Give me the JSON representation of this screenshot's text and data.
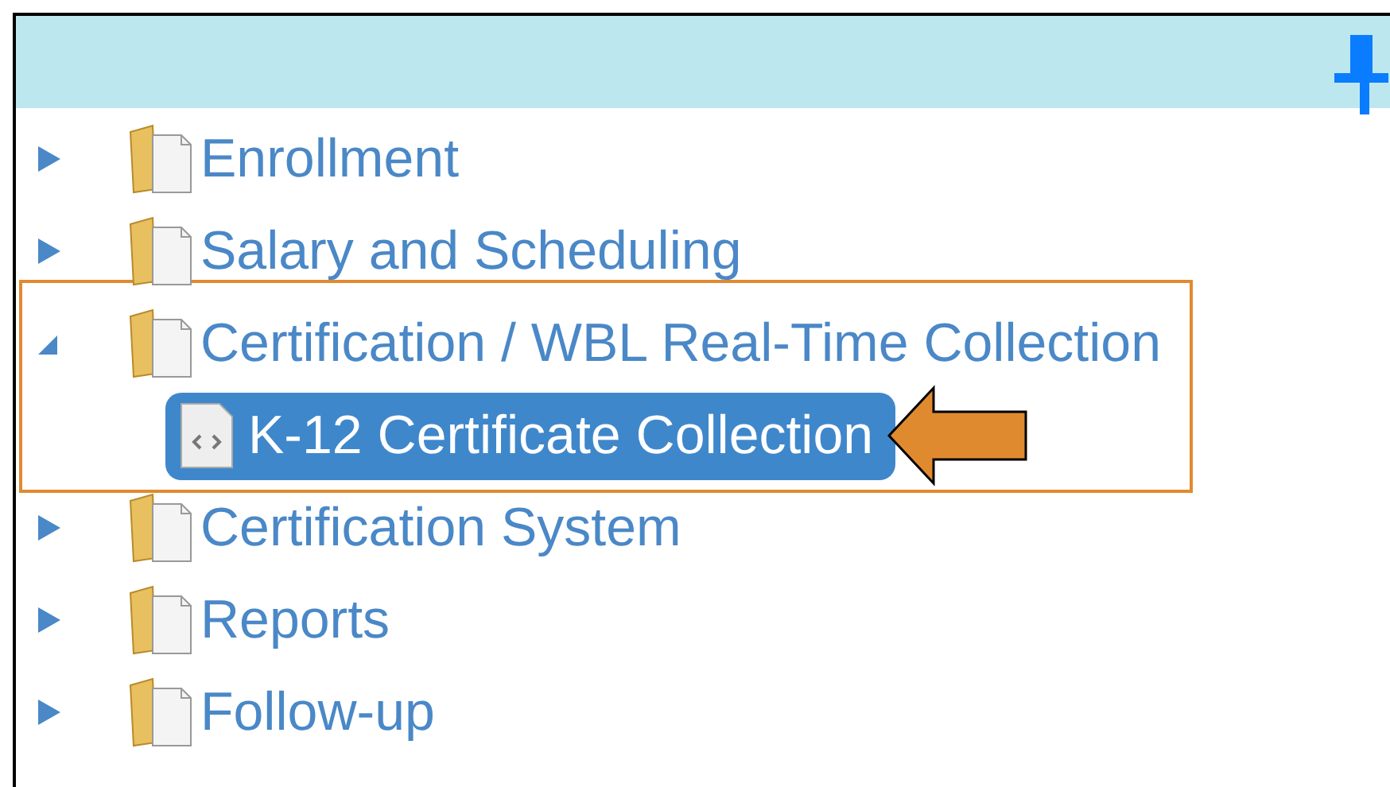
{
  "tree": [
    {
      "label": "Enrollment",
      "expanded": false,
      "highlighted": false
    },
    {
      "label": "Salary and Scheduling",
      "expanded": false,
      "highlighted": false
    },
    {
      "label": "Certification / WBL Real-Time Collection",
      "expanded": true,
      "highlighted": true,
      "children": [
        {
          "label": "K-12 Certificate Collection",
          "selected": true
        }
      ]
    },
    {
      "label": "Certification System",
      "expanded": false,
      "highlighted": false
    },
    {
      "label": "Reports",
      "expanded": false,
      "highlighted": false
    },
    {
      "label": "Follow-up",
      "expanded": false,
      "highlighted": false
    }
  ]
}
